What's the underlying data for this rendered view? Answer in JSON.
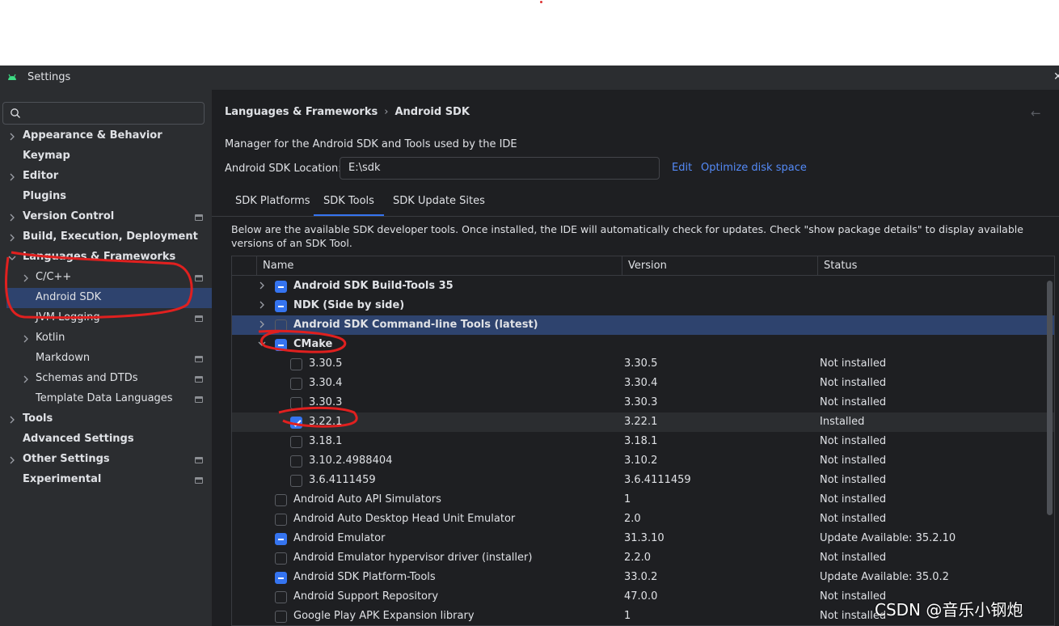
{
  "window": {
    "title": "Settings"
  },
  "sidebar": {
    "search_placeholder": "",
    "items": [
      {
        "label": "Appearance & Behavior",
        "bold": true,
        "expandable": true,
        "project": false
      },
      {
        "label": "Keymap",
        "bold": true,
        "expandable": false,
        "project": false
      },
      {
        "label": "Editor",
        "bold": true,
        "expandable": true,
        "project": false
      },
      {
        "label": "Plugins",
        "bold": true,
        "expandable": false,
        "project": false
      },
      {
        "label": "Version Control",
        "bold": true,
        "expandable": true,
        "project": true
      },
      {
        "label": "Build, Execution, Deployment",
        "bold": true,
        "expandable": true,
        "project": false
      },
      {
        "label": "Languages & Frameworks",
        "bold": true,
        "expandable": true,
        "expanded": true,
        "project": false
      },
      {
        "label": "C/C++",
        "bold": false,
        "expandable": true,
        "project": true,
        "child": true
      },
      {
        "label": "Android SDK",
        "bold": false,
        "expandable": false,
        "project": false,
        "child": true,
        "selected": true
      },
      {
        "label": "JVM Logging",
        "bold": false,
        "expandable": false,
        "project": true,
        "child": true
      },
      {
        "label": "Kotlin",
        "bold": false,
        "expandable": true,
        "project": false,
        "child": true
      },
      {
        "label": "Markdown",
        "bold": false,
        "expandable": false,
        "project": true,
        "child": true
      },
      {
        "label": "Schemas and DTDs",
        "bold": false,
        "expandable": true,
        "project": true,
        "child": true
      },
      {
        "label": "Template Data Languages",
        "bold": false,
        "expandable": false,
        "project": true,
        "child": true
      },
      {
        "label": "Tools",
        "bold": true,
        "expandable": true,
        "project": false
      },
      {
        "label": "Advanced Settings",
        "bold": true,
        "expandable": false,
        "project": false
      },
      {
        "label": "Other Settings",
        "bold": true,
        "expandable": true,
        "project": true
      },
      {
        "label": "Experimental",
        "bold": true,
        "expandable": false,
        "project": true
      }
    ]
  },
  "main": {
    "breadcrumb": [
      "Languages & Frameworks",
      "Android SDK"
    ],
    "breadcrumb_sep": "›",
    "description": "Manager for the Android SDK and Tools used by the IDE",
    "location_label": "Android SDK Location:",
    "location_value": "E:\\sdk",
    "edit_link": "Edit",
    "optimize_link": "Optimize disk space",
    "tabs": [
      {
        "label": "SDK Platforms",
        "active": false
      },
      {
        "label": "SDK Tools",
        "active": true
      },
      {
        "label": "SDK Update Sites",
        "active": false
      }
    ],
    "info_text": "Below are the available SDK developer tools. Once installed, the IDE will automatically check for updates. Check \"show package details\" to display available versions of an SDK Tool.",
    "table": {
      "headers": [
        "Name",
        "Version",
        "Status"
      ],
      "rows": [
        {
          "name": "Android SDK Build-Tools 35",
          "version": "",
          "status": "",
          "level": 0,
          "expander": "collapsed",
          "check": "partial",
          "bold": true
        },
        {
          "name": "NDK (Side by side)",
          "version": "",
          "status": "",
          "level": 0,
          "expander": "collapsed",
          "check": "partial",
          "bold": true
        },
        {
          "name": "Android SDK Command-line Tools (latest)",
          "version": "",
          "status": "",
          "level": 0,
          "expander": "collapsed",
          "check": "none",
          "bold": true,
          "highlight": true
        },
        {
          "name": "CMake",
          "version": "",
          "status": "",
          "level": 0,
          "expander": "expanded",
          "check": "partial",
          "bold": true
        },
        {
          "name": "3.30.5",
          "version": "3.30.5",
          "status": "Not installed",
          "level": 1,
          "check": "none"
        },
        {
          "name": "3.30.4",
          "version": "3.30.4",
          "status": "Not installed",
          "level": 1,
          "check": "none"
        },
        {
          "name": "3.30.3",
          "version": "3.30.3",
          "status": "Not installed",
          "level": 1,
          "check": "none"
        },
        {
          "name": "3.22.1",
          "version": "3.22.1",
          "status": "Installed",
          "level": 1,
          "check": "checked",
          "hover": true
        },
        {
          "name": "3.18.1",
          "version": "3.18.1",
          "status": "Not installed",
          "level": 1,
          "check": "none"
        },
        {
          "name": "3.10.2.4988404",
          "version": "3.10.2",
          "status": "Not installed",
          "level": 1,
          "check": "none"
        },
        {
          "name": "3.6.4111459",
          "version": "3.6.4111459",
          "status": "Not installed",
          "level": 1,
          "check": "none"
        },
        {
          "name": "Android Auto API Simulators",
          "version": "1",
          "status": "Not installed",
          "level": 0,
          "check": "none"
        },
        {
          "name": "Android Auto Desktop Head Unit Emulator",
          "version": "2.0",
          "status": "Not installed",
          "level": 0,
          "check": "none"
        },
        {
          "name": "Android Emulator",
          "version": "31.3.10",
          "status": "Update Available: 35.2.10",
          "level": 0,
          "check": "partial"
        },
        {
          "name": "Android Emulator hypervisor driver (installer)",
          "version": "2.2.0",
          "status": "Not installed",
          "level": 0,
          "check": "none"
        },
        {
          "name": "Android SDK Platform-Tools",
          "version": "33.0.2",
          "status": "Update Available: 35.0.2",
          "level": 0,
          "check": "partial"
        },
        {
          "name": "Android Support Repository",
          "version": "47.0.0",
          "status": "Not installed",
          "level": 0,
          "check": "none"
        },
        {
          "name": "Google Play APK Expansion library",
          "version": "1",
          "status": "Not installed",
          "level": 0,
          "check": "none"
        }
      ]
    }
  },
  "watermark": "CSDN @音乐小钢炮",
  "colors": {
    "accent": "#3574f0",
    "selection": "#2e436e",
    "annotation": "#e0201f",
    "link": "#548af7"
  }
}
